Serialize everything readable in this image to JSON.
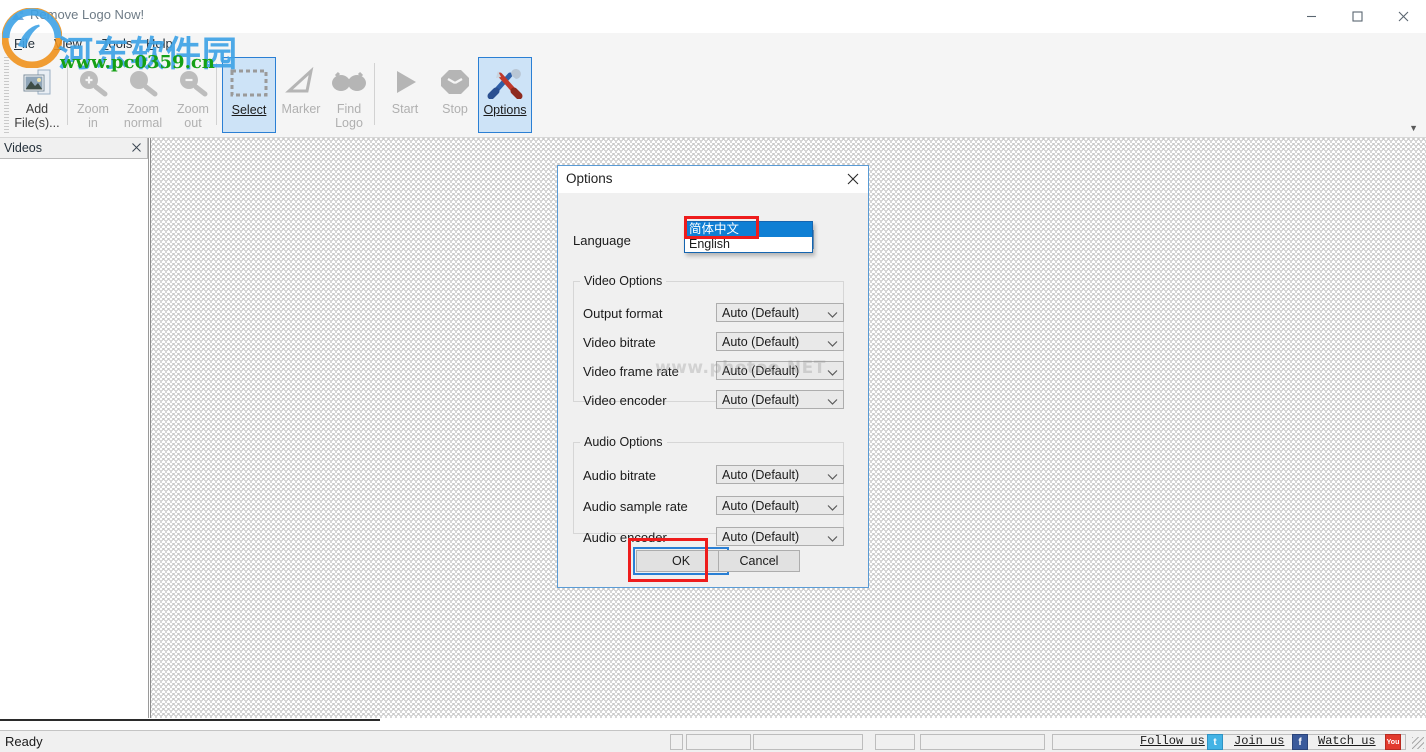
{
  "window": {
    "title": "Remove Logo Now!",
    "minimize_label": "Minimize",
    "maximize_label": "Maximize",
    "close_label": "Close"
  },
  "menubar": {
    "items": [
      {
        "label": "File",
        "accel": "F"
      },
      {
        "label": "View",
        "accel": "V"
      },
      {
        "label": "Tools",
        "accel": "T"
      },
      {
        "label": "Help",
        "accel": "H"
      }
    ]
  },
  "toolbar": {
    "buttons": [
      {
        "id": "add-files",
        "line1": "Add",
        "line2": "File(s)...",
        "state": "enabled"
      },
      {
        "id": "zoom-in",
        "line1": "Zoom",
        "line2": "in",
        "state": "disabled"
      },
      {
        "id": "zoom-normal",
        "line1": "Zoom",
        "line2": "normal",
        "state": "disabled"
      },
      {
        "id": "zoom-out",
        "line1": "Zoom",
        "line2": "out",
        "state": "disabled"
      },
      {
        "id": "select",
        "line1": "Select",
        "line2": "",
        "state": "selected"
      },
      {
        "id": "marker",
        "line1": "Marker",
        "line2": "",
        "state": "disabled"
      },
      {
        "id": "find-logo",
        "line1": "Find",
        "line2": "Logo",
        "state": "disabled"
      },
      {
        "id": "start",
        "line1": "Start",
        "line2": "",
        "state": "disabled"
      },
      {
        "id": "stop",
        "line1": "Stop",
        "line2": "",
        "state": "disabled"
      },
      {
        "id": "options",
        "line1": "Options",
        "line2": "",
        "state": "selected"
      }
    ],
    "overflow_label": "More"
  },
  "dock": {
    "title": "Videos",
    "close_label": "Close panel"
  },
  "dialog": {
    "title": "Options",
    "close_label": "Close",
    "language_label": "Language",
    "language_value": "English",
    "language_options": [
      {
        "label": "简体中文",
        "highlighted": true
      },
      {
        "label": "English",
        "highlighted": false
      }
    ],
    "video_group": "Video Options",
    "audio_group": "Audio Options",
    "video_rows": [
      {
        "label": "Output format",
        "value": "Auto (Default)"
      },
      {
        "label": "Video bitrate",
        "value": "Auto (Default)"
      },
      {
        "label": "Video frame rate",
        "value": "Auto (Default)"
      },
      {
        "label": "Video encoder",
        "value": "Auto (Default)"
      }
    ],
    "audio_rows": [
      {
        "label": "Audio bitrate",
        "value": "Auto (Default)"
      },
      {
        "label": "Audio sample rate",
        "value": "Auto (Default)"
      },
      {
        "label": "Audio encoder",
        "value": "Auto (Default)"
      }
    ],
    "ok_label": "OK",
    "cancel_label": "Cancel"
  },
  "statusbar": {
    "ready_text": "Ready",
    "follow_label": "Follow us",
    "join_label": "Join us",
    "watch_label": "Watch us",
    "twitter_glyph": "t",
    "facebook_glyph": "f",
    "youtube_glyph": "You"
  },
  "watermarks": {
    "site_cn": "河东软件园",
    "site_url": "www.pc0359.cn",
    "faint": "www.photoo.NET"
  },
  "colors": {
    "accent_blue": "#2a7fd4",
    "highlight_blue": "#0f7fd4",
    "annotation_red": "#ee1c1c",
    "ribbon_bg": "#f5f5f5",
    "dialog_bg": "#f0f0f0",
    "wm_blue": "#3fa3e6",
    "wm_green": "#15a015"
  }
}
